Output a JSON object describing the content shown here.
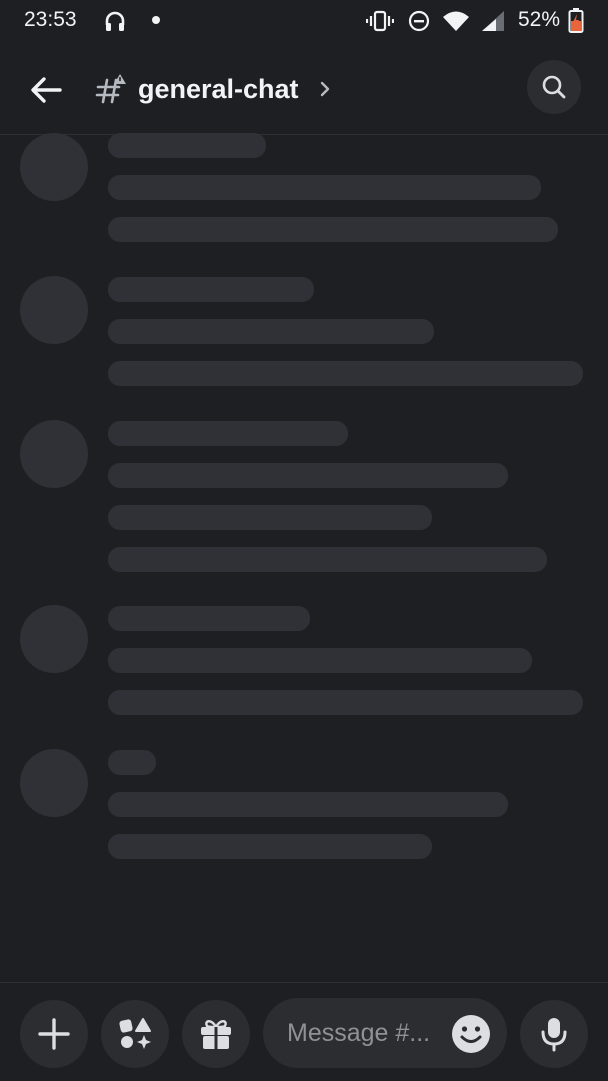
{
  "status_bar": {
    "time": "23:53",
    "battery": "52%"
  },
  "header": {
    "channel_name": "general-chat"
  },
  "composer": {
    "placeholder": "Message #..."
  },
  "colors": {
    "background": "#1e1f22",
    "skeleton": "#2f3136",
    "button_bg": "#2b2d31",
    "text": "#f2f3f5",
    "battery_accent": "#e8643a"
  },
  "icons": [
    "headphones-icon",
    "dot-icon",
    "vibrate-icon",
    "dnd-icon",
    "wifi-icon",
    "signal-icon",
    "battery-icon",
    "back-arrow-icon",
    "text-channel-icon",
    "chevron-right-icon",
    "search-icon",
    "plus-icon",
    "apps-icon",
    "gift-icon",
    "emoji-icon",
    "microphone-icon"
  ]
}
